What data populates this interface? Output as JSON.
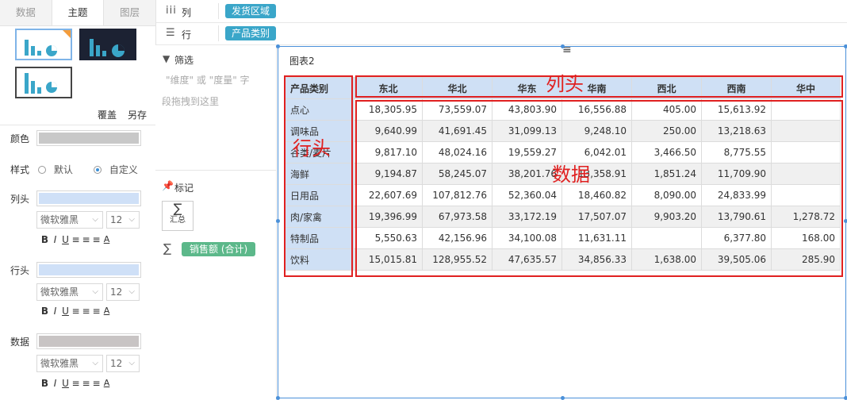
{
  "left_panel": {
    "tabs": [
      "数据",
      "主题",
      "图层"
    ],
    "actions": {
      "cover": "覆盖",
      "save_as": "另存"
    },
    "color_label": "颜色",
    "style": {
      "label": "样式",
      "default": "默认",
      "custom": "自定义"
    },
    "sections": [
      {
        "label": "列头",
        "font": "微软雅黑",
        "size": "12",
        "color": "#cfe0f7"
      },
      {
        "label": "行头",
        "font": "微软雅黑",
        "size": "12",
        "color": "#cfe0f7"
      },
      {
        "label": "数据",
        "font": "微软雅黑",
        "size": "12",
        "color": "#c8c4c4"
      }
    ],
    "format_buttons": [
      "B",
      "I",
      "U",
      "≡",
      "≡",
      "≡",
      "A"
    ]
  },
  "shelves": {
    "columns": {
      "label": "列",
      "field": "发货区域"
    },
    "rows": {
      "label": "行",
      "field": "产品类别"
    }
  },
  "mid_panel": {
    "filter": {
      "title": "筛选",
      "hint_line1": "\"维度\" 或 \"度量\" 字",
      "hint_line2": "段拖拽到这里"
    },
    "marks": {
      "title": "标记",
      "summary_label": "汇总",
      "measure": "销售额 (合计)"
    }
  },
  "chart": {
    "title": "图表2",
    "annotations": {
      "column_header": "列头",
      "row_header": "行头",
      "data": "数据"
    }
  },
  "chart_data": {
    "type": "table",
    "corner": "产品类别",
    "columns": [
      "东北",
      "华北",
      "华东",
      "华南",
      "西北",
      "西南",
      "华中"
    ],
    "rows": [
      {
        "name": "点心",
        "values": [
          "18,305.95",
          "73,559.07",
          "43,803.90",
          "16,556.88",
          "405.00",
          "15,613.92",
          ""
        ]
      },
      {
        "name": "调味品",
        "values": [
          "9,640.99",
          "41,691.45",
          "31,099.13",
          "9,248.10",
          "250.00",
          "13,218.63",
          ""
        ]
      },
      {
        "name": "谷类/麦片",
        "values": [
          "9,817.10",
          "48,024.16",
          "19,559.27",
          "6,042.01",
          "3,466.50",
          "8,775.55",
          ""
        ]
      },
      {
        "name": "海鲜",
        "values": [
          "9,194.87",
          "58,245.07",
          "38,201.76",
          "13,358.91",
          "1,851.24",
          "11,709.90",
          ""
        ]
      },
      {
        "name": "日用品",
        "values": [
          "22,607.69",
          "107,812.76",
          "52,360.04",
          "18,460.82",
          "8,090.00",
          "24,833.99",
          ""
        ]
      },
      {
        "name": "肉/家禽",
        "values": [
          "19,396.99",
          "67,973.58",
          "33,172.19",
          "17,507.07",
          "9,903.20",
          "13,790.61",
          "1,278.72"
        ]
      },
      {
        "name": "特制品",
        "values": [
          "5,550.63",
          "42,156.96",
          "34,100.08",
          "11,631.11",
          "",
          "6,377.80",
          "168.00"
        ]
      },
      {
        "name": "饮料",
        "values": [
          "15,015.81",
          "128,955.52",
          "47,635.57",
          "34,856.33",
          "1,638.00",
          "39,505.06",
          "285.90"
        ]
      }
    ]
  },
  "colors": {
    "accent": "#3aa6c9",
    "measure": "#5cb88a",
    "selection": "#4a90d9",
    "annotation": "#e02020"
  }
}
